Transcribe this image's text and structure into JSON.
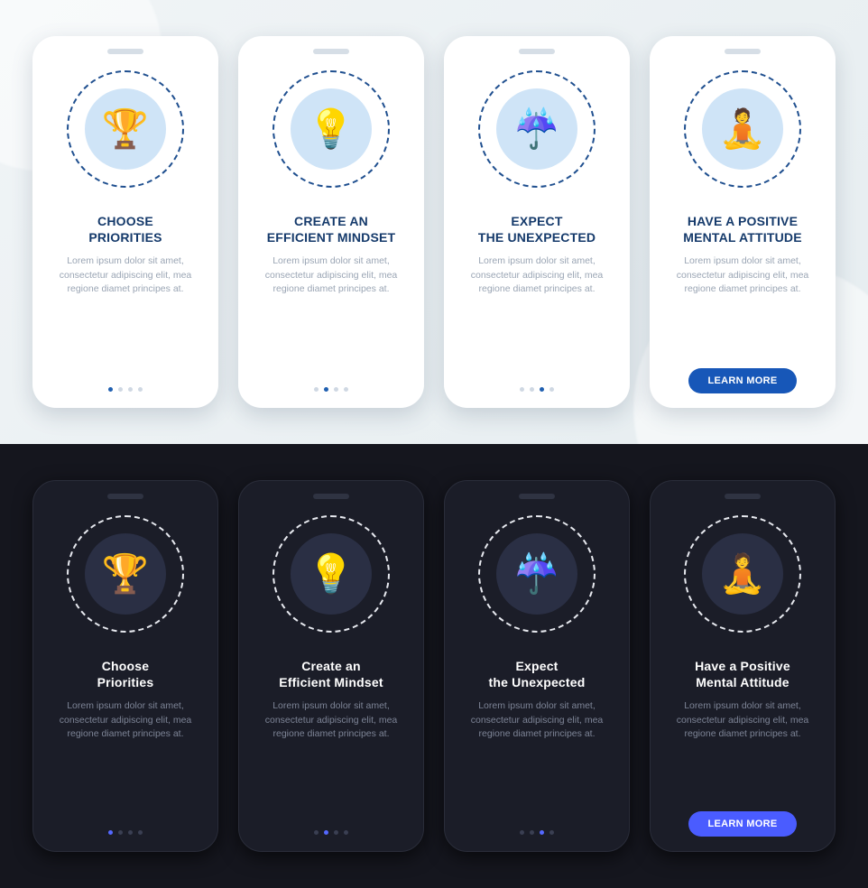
{
  "cta_label": "LEARN MORE",
  "placeholder_desc": "Lorem ipsum dolor sit amet, consectetur adipiscing elit, mea regione diamet principes at.",
  "light": {
    "screens": [
      {
        "title": "CHOOSE\nPRIORITIES",
        "icon": "priorities-icon",
        "active_index": 0
      },
      {
        "title": "CREATE AN\nEFFICIENT MINDSET",
        "icon": "mindset-icon",
        "active_index": 1
      },
      {
        "title": "EXPECT\nTHE UNEXPECTED",
        "icon": "unexpected-icon",
        "active_index": 2
      },
      {
        "title": "HAVE A POSITIVE\nMENTAL ATTITUDE",
        "icon": "attitude-icon",
        "active_index": 3,
        "cta": true
      }
    ]
  },
  "dark": {
    "screens": [
      {
        "title": "Choose\nPriorities",
        "icon": "priorities-icon",
        "active_index": 0
      },
      {
        "title": "Create an\nEfficient Mindset",
        "icon": "mindset-icon",
        "active_index": 1
      },
      {
        "title": "Expect\nthe Unexpected",
        "icon": "unexpected-icon",
        "active_index": 2
      },
      {
        "title": "Have a Positive\nMental Attitude",
        "icon": "attitude-icon",
        "active_index": 3,
        "cta": true
      }
    ]
  },
  "icon_glyphs": {
    "priorities-icon": "🏆",
    "mindset-icon": "💡",
    "unexpected-icon": "☔",
    "attitude-icon": "🧘"
  }
}
